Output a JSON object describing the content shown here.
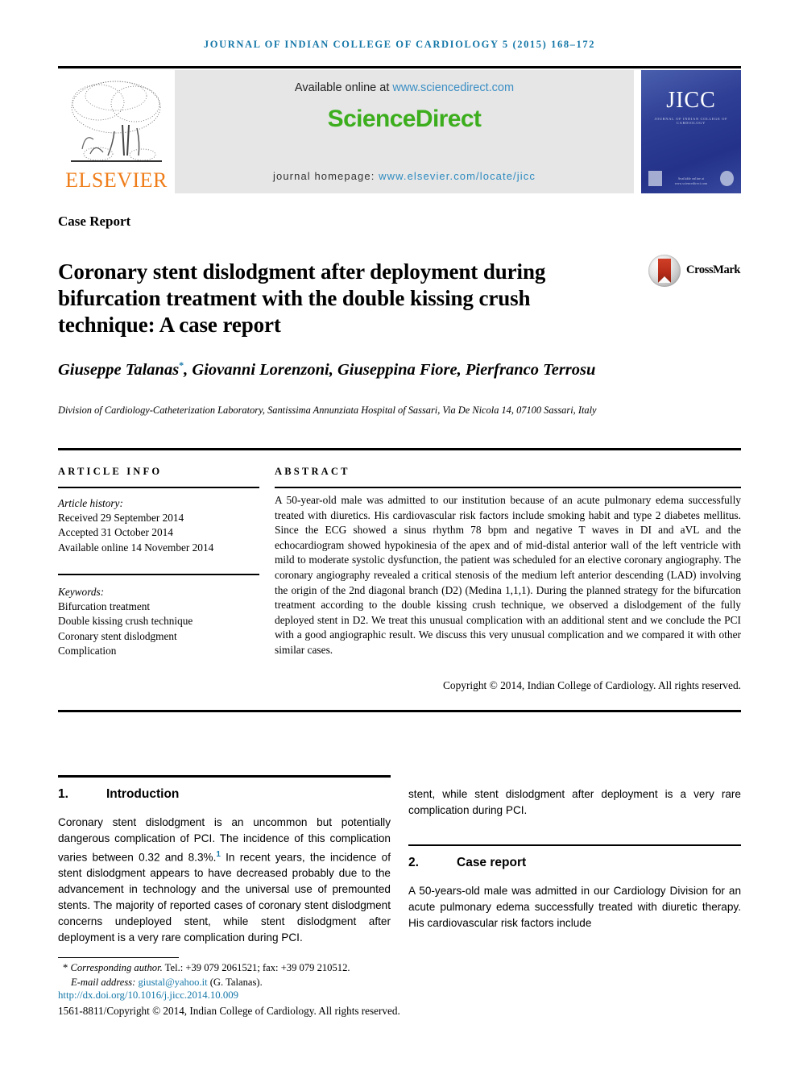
{
  "running_head": "JOURNAL OF INDIAN COLLEGE OF CARDIOLOGY 5 (2015) 168–172",
  "masthead": {
    "publisher_name": "ELSEVIER",
    "publisher_logo_icon": "elsevier-tree-logo",
    "available_prefix": "Available online at ",
    "available_url": "www.sciencedirect.com",
    "sciencedirect_wordmark": "ScienceDirect",
    "homepage_prefix": "journal homepage: ",
    "homepage_url": "www.elsevier.com/locate/jicc",
    "cover": {
      "acronym": "JICC",
      "subtitle": "JOURNAL OF INDIAN COLLEGE OF CARDIOLOGY",
      "publisher_small": "Available online at www.sciencedirect.com"
    }
  },
  "article": {
    "type": "Case Report",
    "title": "Coronary stent dislodgment after deployment during bifurcation treatment with the double kissing crush technique: A case report",
    "crossmark_label": "CrossMark",
    "authors": "Giuseppe Talanas",
    "authors_star": "*",
    "authors_rest": ", Giovanni Lorenzoni, Giuseppina Fiore, Pierfranco Terrosu",
    "affiliation": "Division of Cardiology-Catheterization Laboratory, Santissima Annunziata Hospital of Sassari, Via De Nicola 14, 07100 Sassari, Italy"
  },
  "info": {
    "heading": "ARTICLE INFO",
    "history_label": "Article history:",
    "received": "Received 29 September 2014",
    "accepted": "Accepted 31 October 2014",
    "available_online": "Available online 14 November 2014",
    "keywords_label": "Keywords:",
    "keywords": [
      "Bifurcation treatment",
      "Double kissing crush technique",
      "Coronary stent dislodgment",
      "Complication"
    ]
  },
  "abstract": {
    "heading": "ABSTRACT",
    "text": "A 50-year-old male was admitted to our institution because of an acute pulmonary edema successfully treated with diuretics. His cardiovascular risk factors include smoking habit and type 2 diabetes mellitus. Since the ECG showed a sinus rhythm 78 bpm and negative T waves in DI and aVL and the echocardiogram showed hypokinesia of the apex and of mid-distal anterior wall of the left ventricle with mild to moderate systolic dysfunction, the patient was scheduled for an elective coronary angiography. The coronary angiography revealed a critical stenosis of the medium left anterior descending (LAD) involving the origin of the 2nd diagonal branch (D2) (Medina 1,1,1). During the planned strategy for the bifurcation treatment according to the double kissing crush technique, we observed a dislodgement of the fully deployed stent in D2. We treat this unusual complication with an additional stent and we conclude the PCI with a good angiographic result. We discuss this very unusual complication and we compared it with other similar cases.",
    "copyright": "Copyright © 2014, Indian College of Cardiology. All rights reserved."
  },
  "body": {
    "section1": {
      "number": "1.",
      "title": "Introduction",
      "paragraph_part1": "Coronary stent dislodgment is an uncommon but potentially dangerous complication of PCI. The incidence of this complication varies between 0.32 and 8.3%.",
      "paragraph_ref": "1",
      "paragraph_part2": " In recent years, the incidence of stent dislodgment appears to have decreased probably due to the advancement in technology and the universal use of premounted stents. The majority of reported cases of coronary stent dislodgment concerns undeployed stent, while stent dislodgment after deployment is a very rare complication during PCI."
    },
    "continuation": "stent, while stent dislodgment after deployment is a very rare complication during PCI.",
    "section2": {
      "number": "2.",
      "title": "Case report",
      "paragraph": "A 50-years-old male was admitted in our Cardiology Division for an acute pulmonary edema successfully treated with diuretic therapy. His cardiovascular risk factors include"
    }
  },
  "footer": {
    "corresponding_marker": "*",
    "corresponding_label": "Corresponding author.",
    "corresponding_contact": " Tel.: +39 079 2061521; fax: +39 079 210512.",
    "email_label": "E-mail address: ",
    "email": "giustal@yahoo.it",
    "email_owner": " (G. Talanas).",
    "doi": "http://dx.doi.org/10.1016/j.jicc.2014.10.009",
    "issn_line": "1561-8811/Copyright © 2014, Indian College of Cardiology. All rights reserved."
  },
  "colors": {
    "accent_blue": "#1577a8",
    "link_blue": "#2e8bc0",
    "elsevier_orange": "#ef7d1a",
    "sciencedirect_green": "#3cae1d",
    "cover_blue": "#2f3f95"
  }
}
